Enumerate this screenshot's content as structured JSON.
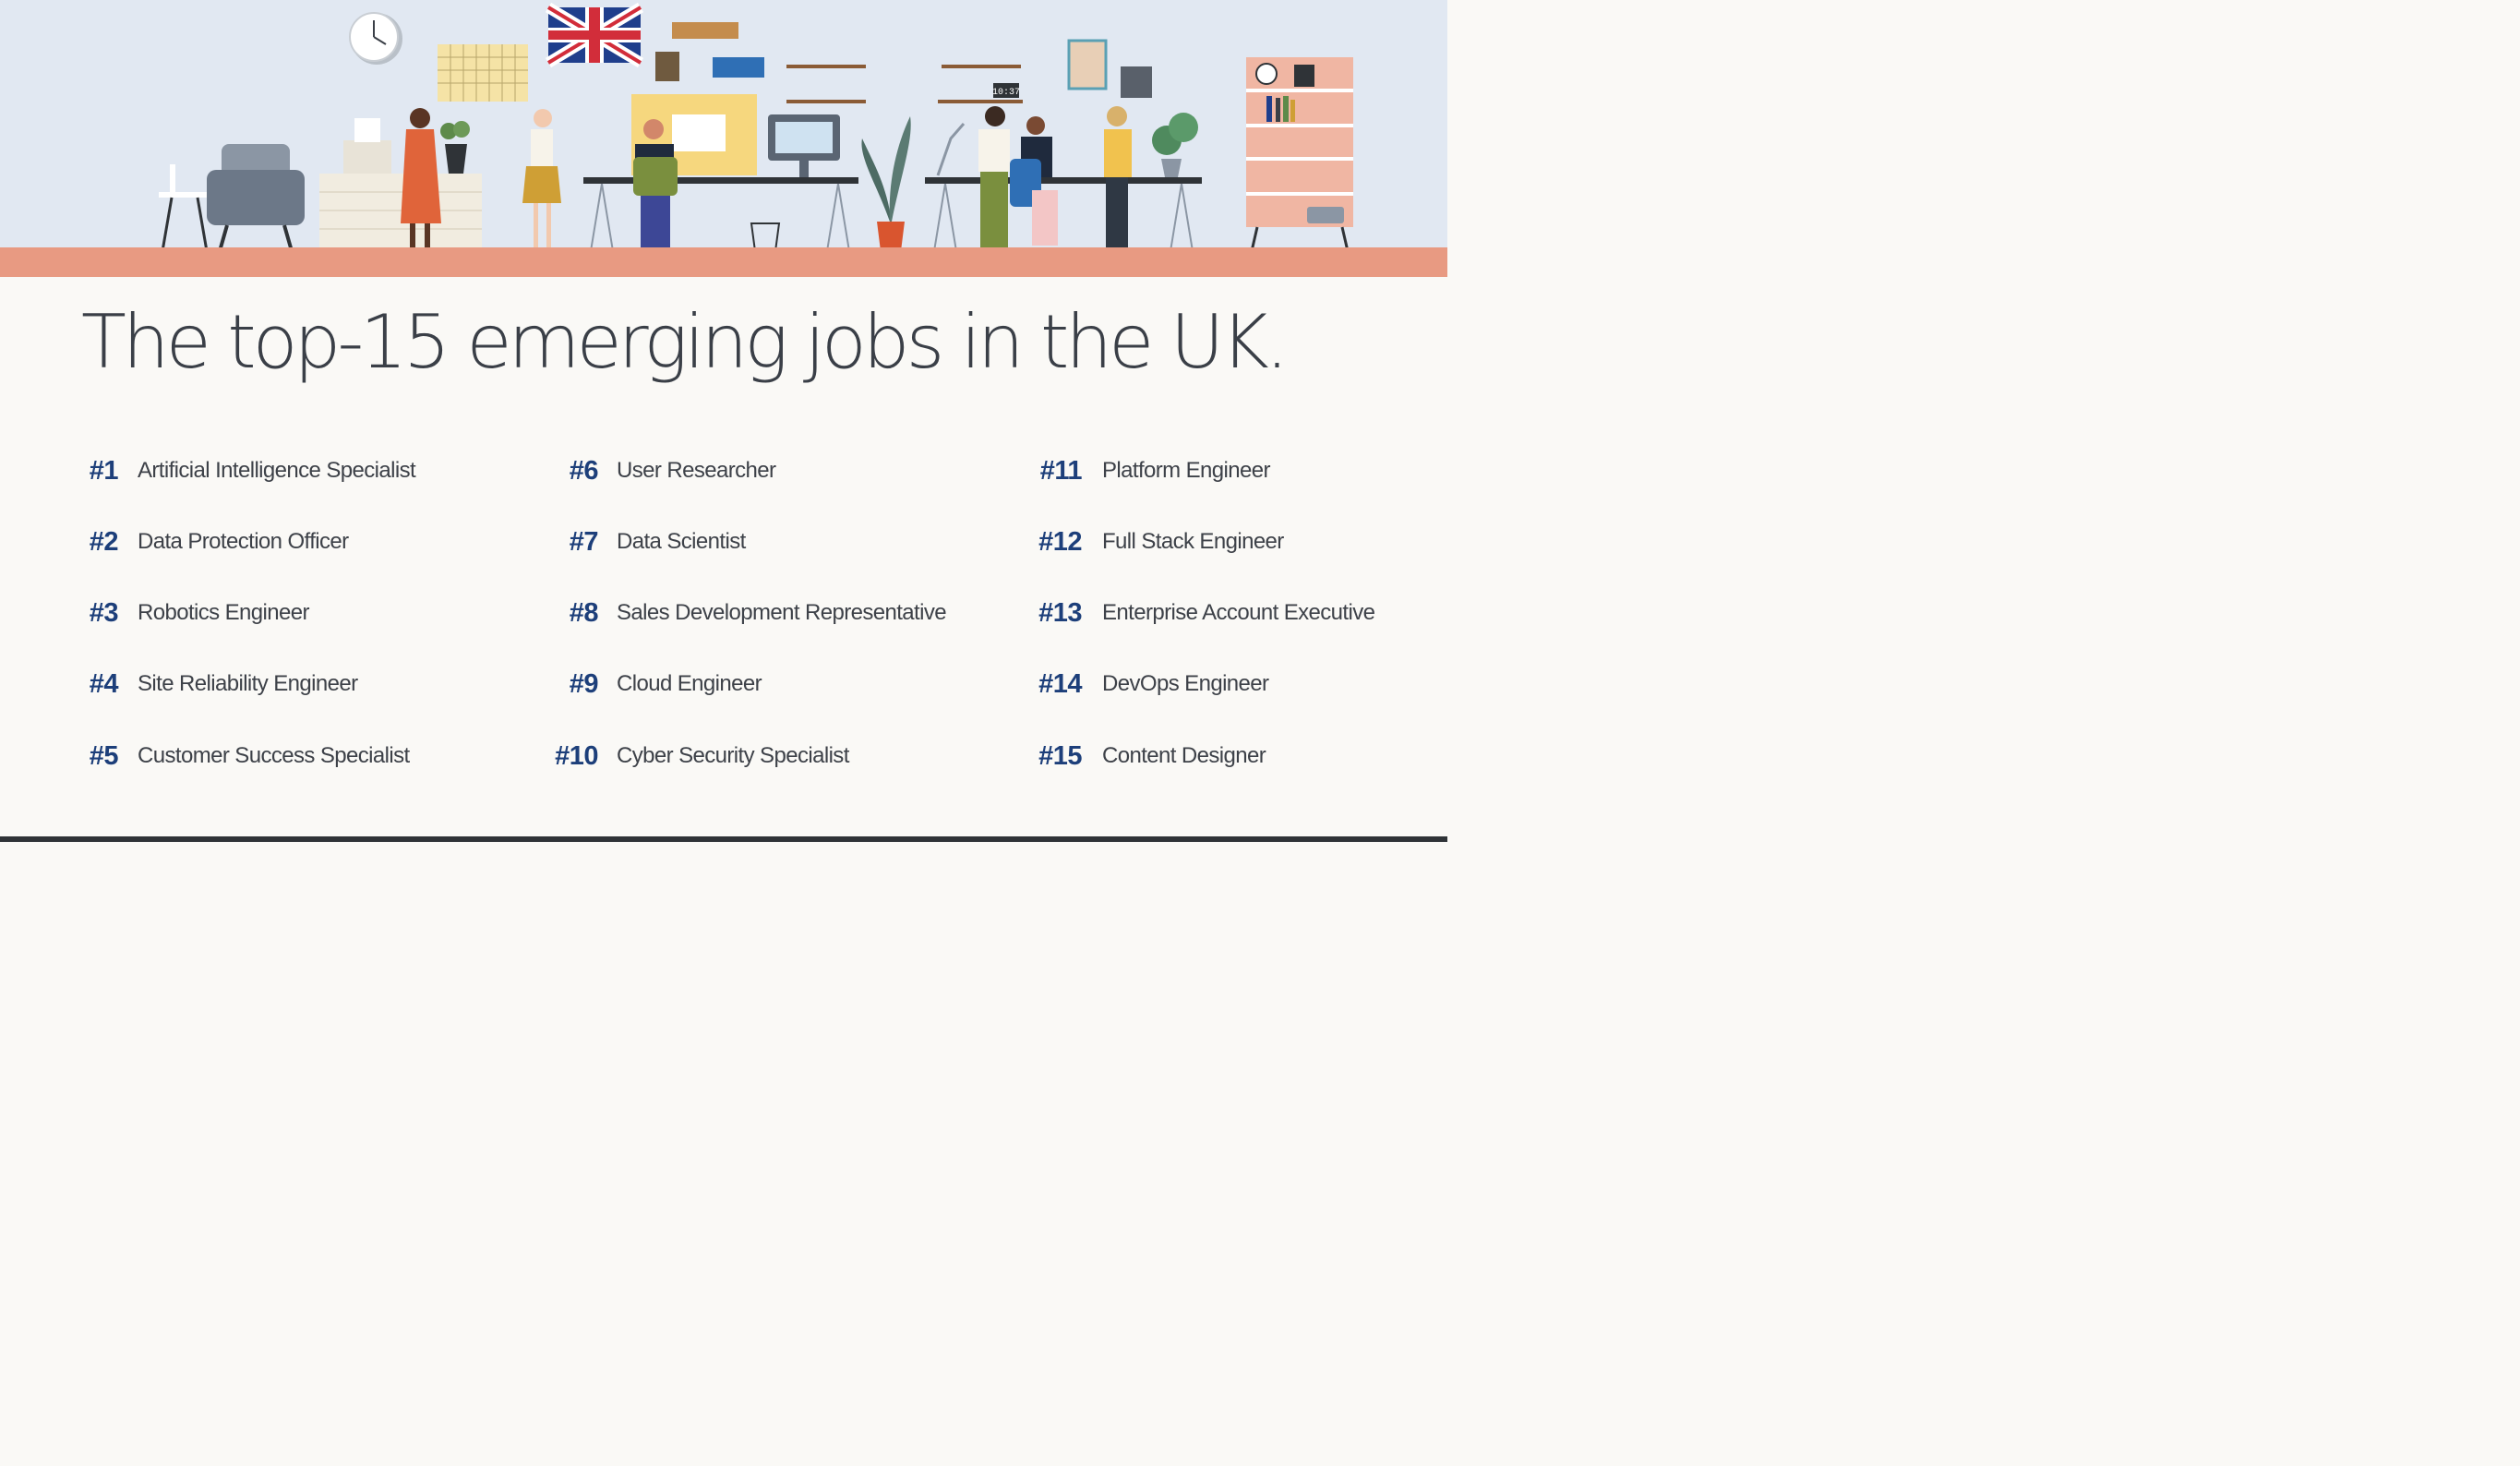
{
  "headline": "The top-15 emerging jobs in the UK.",
  "scene": {
    "clock_icon": "wall-clock-icon",
    "flag_icon": "union-jack-flag-icon",
    "digital_clock_text": "10:37",
    "colors": {
      "wall": "#e1e8f2",
      "floor": "#e89a82",
      "rank_text": "#1d3f7a",
      "body_text": "#3d4148"
    }
  },
  "jobs": [
    {
      "rank": "#1",
      "title": "Artificial Intelligence Specialist"
    },
    {
      "rank": "#2",
      "title": "Data Protection Officer"
    },
    {
      "rank": "#3",
      "title": "Robotics Engineer"
    },
    {
      "rank": "#4",
      "title": "Site Reliability Engineer"
    },
    {
      "rank": "#5",
      "title": "Customer Success Specialist"
    },
    {
      "rank": "#6",
      "title": "User Researcher"
    },
    {
      "rank": "#7",
      "title": "Data Scientist"
    },
    {
      "rank": "#8",
      "title": "Sales Development Representative"
    },
    {
      "rank": "#9",
      "title": "Cloud Engineer"
    },
    {
      "rank": "#10",
      "title": "Cyber Security Specialist"
    },
    {
      "rank": "#11",
      "title": "Platform Engineer"
    },
    {
      "rank": "#12",
      "title": "Full Stack Engineer"
    },
    {
      "rank": "#13",
      "title": "Enterprise Account Executive"
    },
    {
      "rank": "#14",
      "title": "DevOps Engineer"
    },
    {
      "rank": "#15",
      "title": "Content Designer"
    }
  ]
}
